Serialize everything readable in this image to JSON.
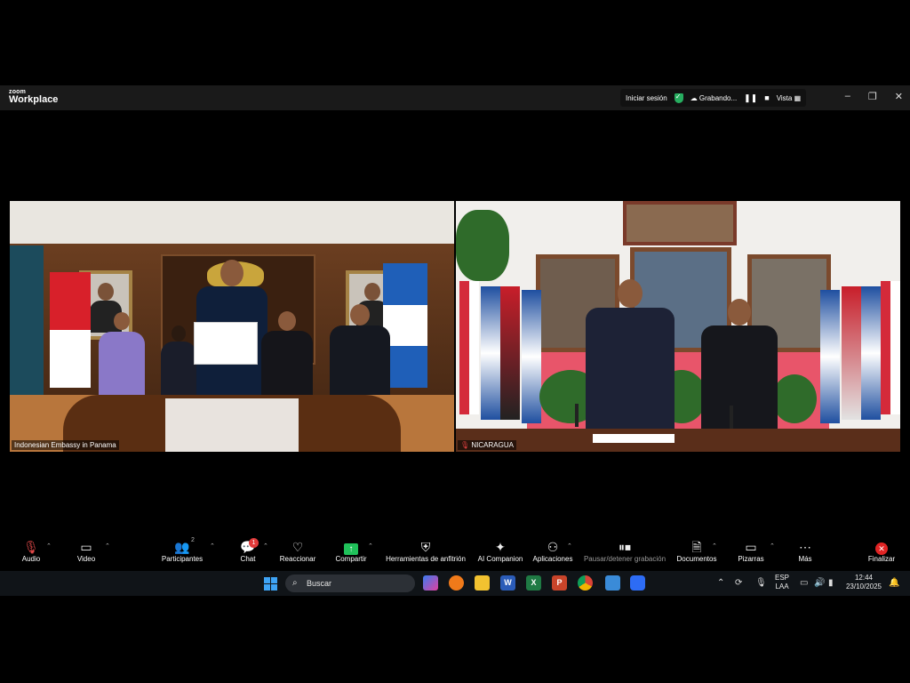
{
  "app": {
    "brand_small": "zoom",
    "brand_big": "Workplace"
  },
  "titlebar": {
    "signin": "Iniciar sesión",
    "recording": "Grabando...",
    "view": "Vista",
    "minimize": "–",
    "restore": "❐",
    "close": "✕"
  },
  "videos": {
    "left": {
      "label": "Indonesian Embassy in Panama"
    },
    "right": {
      "label": "NICARAGUA"
    }
  },
  "toolbar": {
    "audio": "Audio",
    "video": "Video",
    "participants": "Participantes",
    "participants_count": "2",
    "chat": "Chat",
    "chat_badge": "1",
    "react": "Reaccionar",
    "share": "Compartir",
    "host_tools": "Herramientas de anfitrión",
    "ai_companion": "AI Companion",
    "apps": "Aplicaciones",
    "pause_recording": "Pausar/detener grabación",
    "docs": "Documentos",
    "whiteboards": "Pizarras",
    "more": "Más",
    "end": "Finalizar"
  },
  "taskbar": {
    "search_placeholder": "Buscar",
    "lang_top": "ESP",
    "lang_bottom": "LAA",
    "time": "12:44",
    "date": "23/10/2025"
  },
  "colors": {
    "share_green": "#20c15a",
    "end_red": "#e02424",
    "badge_red": "#e03a3a"
  }
}
